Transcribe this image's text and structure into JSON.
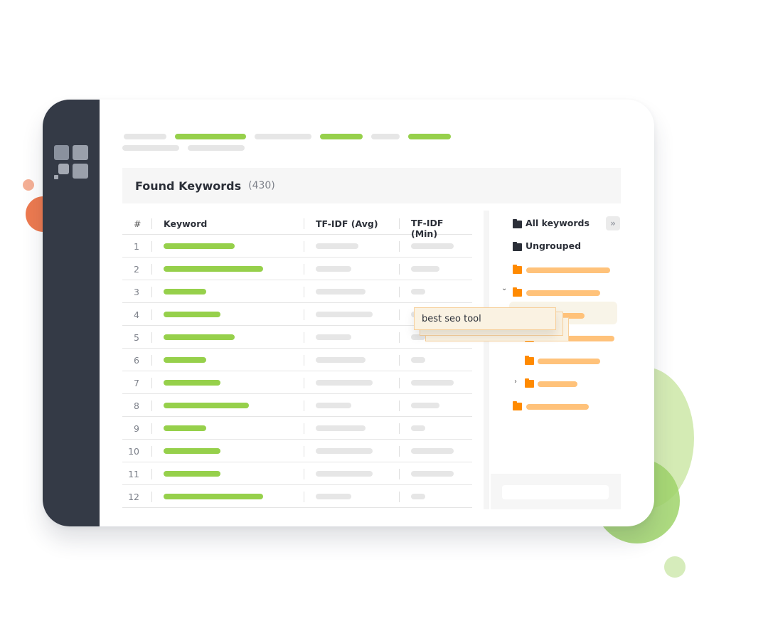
{
  "colors": {
    "sidebar": "#343a46",
    "accent_green": "#96d04b",
    "accent_orange": "#ff8a00",
    "placeholder_gray": "#e6e6e6",
    "drag_card_bg": "#faf2e2"
  },
  "sidebar": {
    "logo_icon": "app-logo-grid-icon"
  },
  "panel": {
    "title": "Found Keywords",
    "count": "(430)"
  },
  "table": {
    "columns": [
      "#",
      "Keyword",
      "TF-IDF (Avg)",
      "TF-IDF (Min)"
    ],
    "rows": [
      {
        "num": "1"
      },
      {
        "num": "2"
      },
      {
        "num": "3"
      },
      {
        "num": "4"
      },
      {
        "num": "5"
      },
      {
        "num": "6"
      },
      {
        "num": "7"
      },
      {
        "num": "8"
      },
      {
        "num": "9"
      },
      {
        "num": "10"
      },
      {
        "num": "11"
      },
      {
        "num": "12"
      }
    ]
  },
  "tree": {
    "items": [
      {
        "label": "All keywords",
        "icon": "folder-icon"
      },
      {
        "label": "Ungrouped",
        "icon": "folder-icon"
      }
    ],
    "collapse_button": "»"
  },
  "drag_item": {
    "label": "best seo tool"
  },
  "carets": {
    "expanded": "⌄",
    "collapsed": "›"
  }
}
